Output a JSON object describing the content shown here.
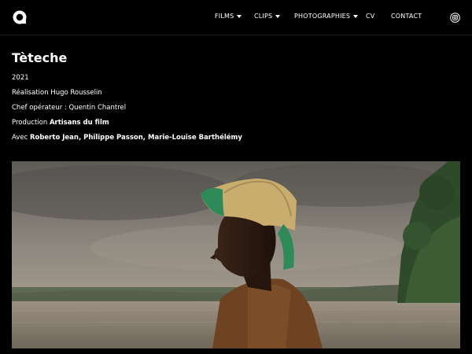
{
  "nav": {
    "items": [
      {
        "label": "FILMS",
        "dropdown": true
      },
      {
        "label": "CLIPS",
        "dropdown": true
      },
      {
        "label": "PHOTOGRAPHIES",
        "dropdown": true
      },
      {
        "label": "CV",
        "dropdown": false
      },
      {
        "label": "CONTACT",
        "dropdown": false
      }
    ]
  },
  "icons": {
    "logo": "logo-icon",
    "social": "instagram-icon",
    "dropdown": "caret-down-icon"
  },
  "film": {
    "title": "Tèteche",
    "year": "2021",
    "director_line": "Réalisation Hugo Rousselin",
    "dop_line": "Chef opérateur : Quentin Chantrel",
    "production_label": "Production",
    "production_value": "Artisans du film",
    "cast_label": "Avec",
    "cast_value": "Roberto Jean, Philippe Passon, Marie-Louise Barthélémy"
  },
  "still": {
    "description_hidden": ""
  },
  "colors": {
    "background": "#000000",
    "text": "#ffffff",
    "hat": "#c9ad6f",
    "hat_lining": "#2f8a5a",
    "shirt": "#7a4a24"
  }
}
